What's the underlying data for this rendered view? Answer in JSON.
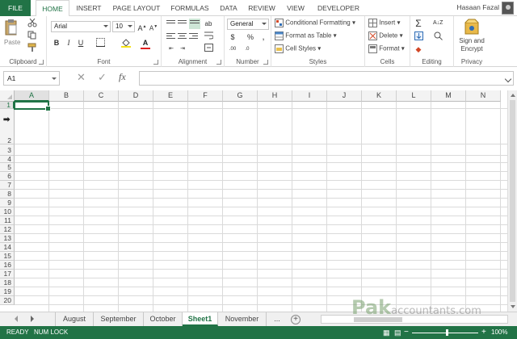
{
  "tabs": [
    {
      "label": "FILE"
    },
    {
      "label": "HOME"
    },
    {
      "label": "INSERT"
    },
    {
      "label": "PAGE LAYOUT"
    },
    {
      "label": "FORMULAS"
    },
    {
      "label": "DATA"
    },
    {
      "label": "REVIEW"
    },
    {
      "label": "VIEW"
    },
    {
      "label": "DEVELOPER"
    }
  ],
  "user_name": "Hasaan Fazal",
  "ribbon": {
    "clipboard": {
      "label": "Clipboard",
      "paste": "Paste"
    },
    "font": {
      "label": "Font",
      "family": "Arial",
      "size": "10"
    },
    "alignment": {
      "label": "Alignment"
    },
    "number": {
      "label": "Number",
      "format": "General"
    },
    "styles": {
      "label": "Styles",
      "conditional": "Conditional Formatting",
      "table": "Format as Table",
      "cell": "Cell Styles"
    },
    "cells": {
      "label": "Cells",
      "insert": "Insert",
      "delete": "Delete",
      "format": "Format"
    },
    "editing": {
      "label": "Editing"
    },
    "privacy": {
      "label": "Privacy",
      "sign1": "Sign and",
      "sign2": "Encrypt"
    }
  },
  "formula_bar": {
    "name_box": "A1",
    "fx": "fx",
    "value": ""
  },
  "columns": [
    "A",
    "B",
    "C",
    "D",
    "E",
    "F",
    "G",
    "H",
    "I",
    "J",
    "K",
    "L",
    "M",
    "N"
  ],
  "rows": [
    "1",
    "2",
    "3",
    "4",
    "5",
    "6",
    "7",
    "8",
    "9",
    "10",
    "11",
    "12",
    "13",
    "14",
    "15",
    "16",
    "17",
    "18",
    "19",
    "20"
  ],
  "active_cell": "A1",
  "sheet_tabs": [
    "August",
    "September",
    "October",
    "Sheet1",
    "November",
    "..."
  ],
  "active_sheet": "Sheet1",
  "status": {
    "ready": "READY",
    "numlock": "NUM LOCK",
    "zoom": "100%"
  },
  "watermark": {
    "main": "Pak",
    "sub": "accountants.com"
  },
  "colors": {
    "accent": "#217346"
  }
}
